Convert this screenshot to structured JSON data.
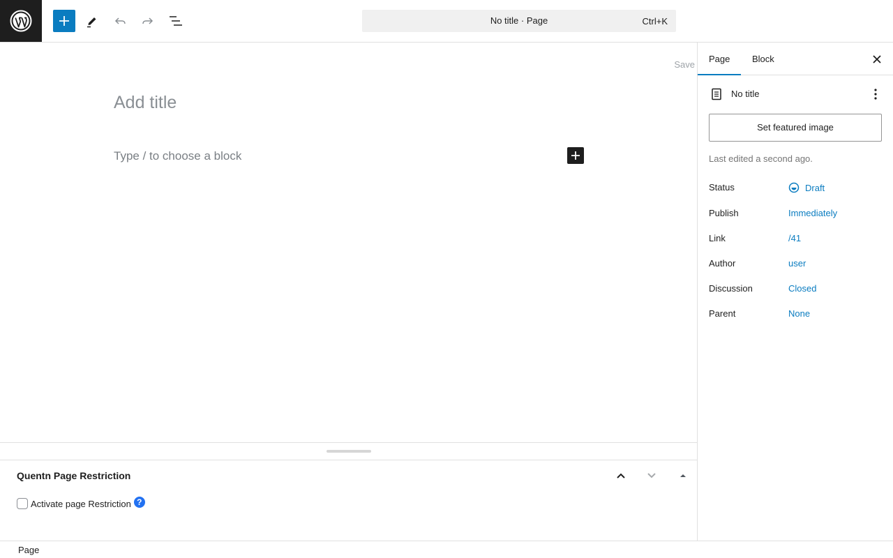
{
  "header": {
    "command_title": "No title · Page",
    "command_shortcut": "Ctrl+K"
  },
  "editor": {
    "save_label": "Save",
    "title_placeholder": "Add title",
    "block_placeholder": "Type / to choose a block"
  },
  "metabox": {
    "title": "Quentn Page Restriction",
    "checkbox_label": "Activate page Restriction",
    "help_glyph": "?"
  },
  "footer": {
    "breadcrumb": "Page"
  },
  "sidebar": {
    "tabs": [
      {
        "label": "Page",
        "active": true
      },
      {
        "label": "Block",
        "active": false
      }
    ],
    "doc_title": "No title",
    "featured_image_label": "Set featured image",
    "last_edited": "Last edited a second ago.",
    "properties": [
      {
        "label": "Status",
        "value": "Draft"
      },
      {
        "label": "Publish",
        "value": "Immediately"
      },
      {
        "label": "Link",
        "value": "/41"
      },
      {
        "label": "Author",
        "value": "user"
      },
      {
        "label": "Discussion",
        "value": "Closed"
      },
      {
        "label": "Parent",
        "value": "None"
      }
    ]
  },
  "colors": {
    "accent": "#0a7cc0",
    "dark": "#1e1e1e",
    "help_blue": "#2271f1"
  },
  "icons": [
    "wordpress-logo-icon",
    "plus-icon",
    "pencil-icon",
    "undo-icon",
    "redo-icon",
    "list-view-icon",
    "close-icon",
    "page-icon",
    "more-vertical-icon",
    "draft-status-icon",
    "chevron-up-icon",
    "chevron-down-icon",
    "triangle-up-icon",
    "help-icon"
  ]
}
